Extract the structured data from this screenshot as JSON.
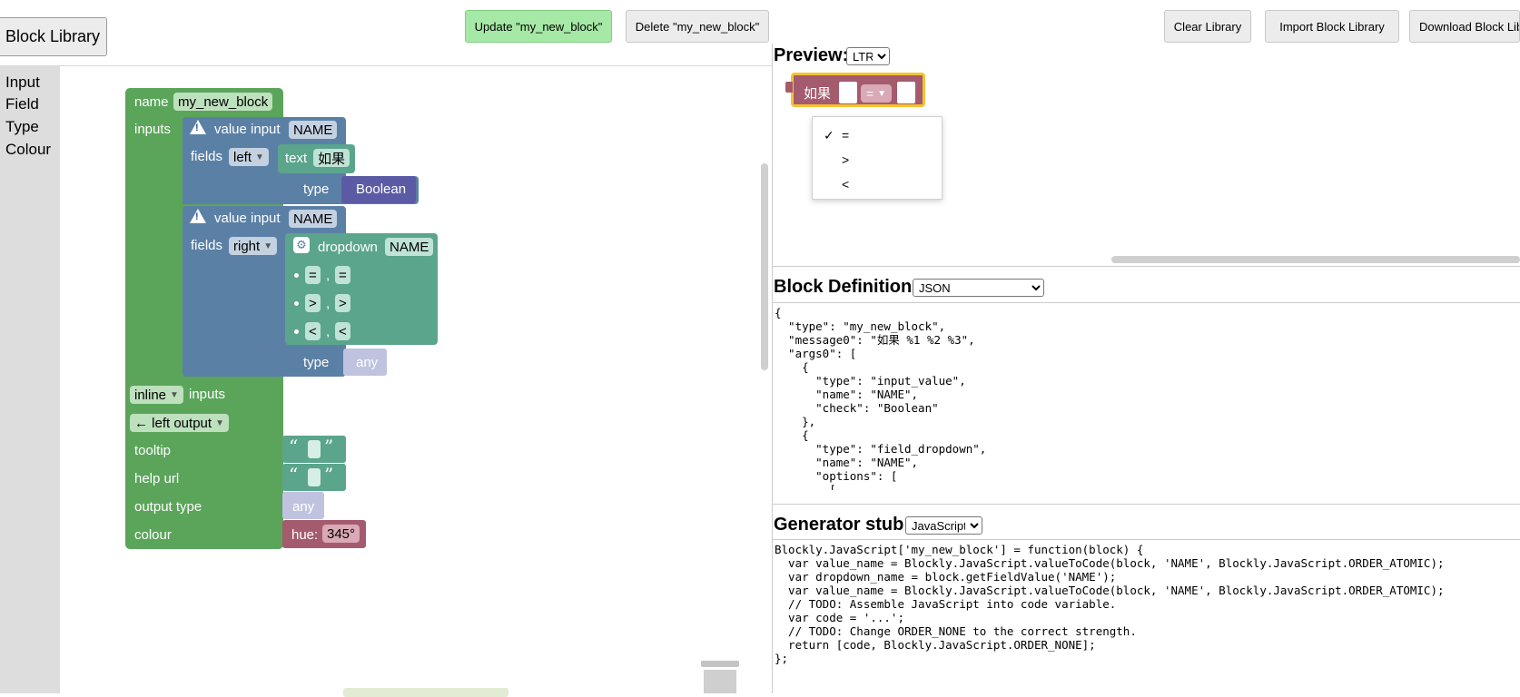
{
  "top": {
    "library_label": "Block Library",
    "update_label": "Update \"my_new_block\"",
    "delete_label": "Delete \"my_new_block\"",
    "clear_label": "Clear Library",
    "import_label": "Import Block Library",
    "download_label": "Download Block Library"
  },
  "toolbox": {
    "items": [
      "Input",
      "Field",
      "Type",
      "Colour"
    ]
  },
  "factory": {
    "name_label": "name",
    "name_value": "my_new_block",
    "inputs_label": "inputs",
    "input1": {
      "label": "value input",
      "name": "NAME",
      "fields_label": "fields",
      "align": "left",
      "text_label": "text",
      "text_value": "如果",
      "type_label": "type",
      "type_value": "Boolean"
    },
    "input2": {
      "label": "value input",
      "name": "NAME",
      "fields_label": "fields",
      "align": "right",
      "dropdown_label": "dropdown",
      "dropdown_name": "NAME",
      "options": [
        {
          "display": "=",
          "value": "="
        },
        {
          "display": ">",
          "value": ">"
        },
        {
          "display": "<",
          "value": "<"
        }
      ],
      "comma": ",",
      "type_label": "type",
      "type_value": "any"
    },
    "inline_value": "inline",
    "inline_suffix": "inputs",
    "output_value": "← left output",
    "tooltip_label": "tooltip",
    "helpurl_label": "help url",
    "output_type_label": "output type",
    "output_type_value": "any",
    "colour_label": "colour",
    "hue_label": "hue:",
    "hue_value": "345°",
    "open_quote": "“",
    "close_quote": "”"
  },
  "preview": {
    "title": "Preview:",
    "direction": "LTR",
    "block_label": "如果",
    "dropdown_value": "=",
    "menu": [
      {
        "label": "=",
        "checked": true
      },
      {
        "label": ">",
        "checked": false
      },
      {
        "label": "<",
        "checked": false
      }
    ],
    "check_mark": "✓"
  },
  "definition": {
    "title": "Block Definition:",
    "format": "JSON",
    "code": "{\n  \"type\": \"my_new_block\",\n  \"message0\": \"如果 %1 %2 %3\",\n  \"args0\": [\n    {\n      \"type\": \"input_value\",\n      \"name\": \"NAME\",\n      \"check\": \"Boolean\"\n    },\n    {\n      \"type\": \"field_dropdown\",\n      \"name\": \"NAME\",\n      \"options\": [\n        ["
  },
  "generator": {
    "title": "Generator stub:",
    "language": "JavaScript",
    "code": "Blockly.JavaScript['my_new_block'] = function(block) {\n  var value_name = Blockly.JavaScript.valueToCode(block, 'NAME', Blockly.JavaScript.ORDER_ATOMIC);\n  var dropdown_name = block.getFieldValue('NAME');\n  var value_name = Blockly.JavaScript.valueToCode(block, 'NAME', Blockly.JavaScript.ORDER_ATOMIC);\n  // TODO: Assemble JavaScript into code variable.\n  var code = '...';\n  // TODO: Change ORDER_NONE to the correct strength.\n  return [code, Blockly.JavaScript.ORDER_NONE];\n};"
  },
  "colors": {
    "factory_green": "#5ba55b",
    "input_blue": "#5b80a5",
    "field_teal": "#5ba58c",
    "type_violet": "#5b5ba5",
    "hue_block": "#a55b6e",
    "selection": "#f4c430",
    "update_button": "#a6e8a6"
  }
}
